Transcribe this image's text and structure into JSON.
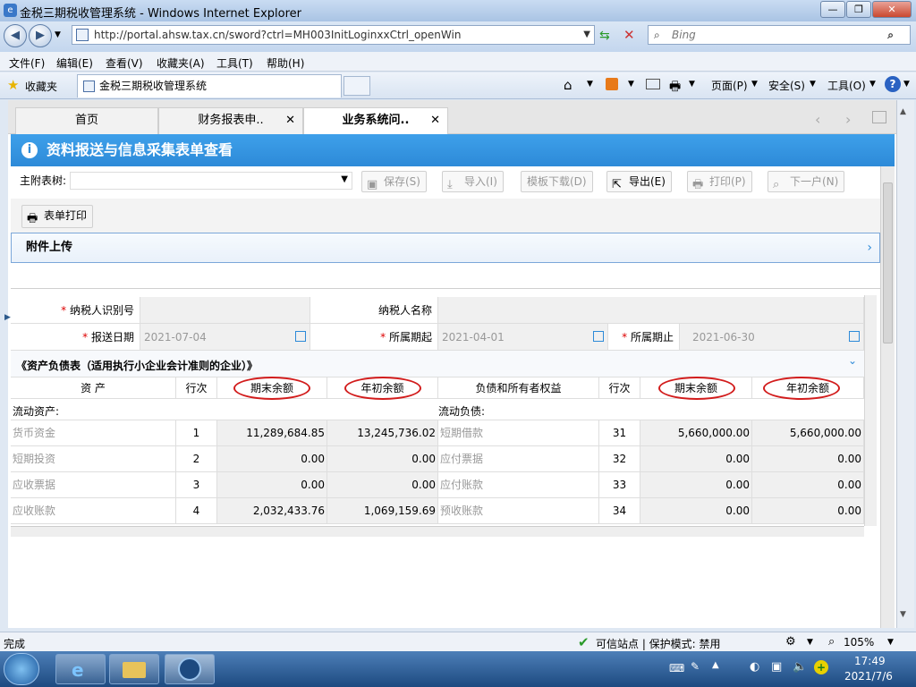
{
  "window": {
    "title": "金税三期税收管理系统 - Windows Internet Explorer"
  },
  "address": {
    "url": "http://portal.ahsw.tax.cn/sword?ctrl=MH003InitLoginxxCtrl_openWin",
    "search_placeholder": "Bing"
  },
  "menu": [
    "文件(F)",
    "编辑(E)",
    "查看(V)",
    "收藏夹(A)",
    "工具(T)",
    "帮助(H)"
  ],
  "favbar": {
    "favorites": "收藏夹",
    "tab": "金税三期税收管理系统",
    "page": "页面(P)",
    "safety": "安全(S)",
    "tools": "工具(O)"
  },
  "app_tabs": [
    {
      "label": "首页"
    },
    {
      "label": "财务报表申.."
    },
    {
      "label": "业务系统问.."
    }
  ],
  "header": {
    "title": "资料报送与信息采集表单查看"
  },
  "toolbar": {
    "tree_label": "主附表树:",
    "save": "保存(S)",
    "import": "导入(I)",
    "template": "模板下载(D)",
    "export": "导出(E)",
    "print": "打印(P)",
    "next": "下一户(N)",
    "form_print": "表单打印"
  },
  "attachment": "附件上传",
  "form": {
    "taxpayer_id_label": "纳税人识别号",
    "taxpayer_name_label": "纳税人名称",
    "report_date_label": "报送日期",
    "report_date": "2021-07-04",
    "period_start_label": "所属期起",
    "period_start": "2021-04-01",
    "period_end_label": "所属期止",
    "period_end": "2021-06-30"
  },
  "table": {
    "title": "《资产负债表（适用执行小企业会计准则的企业）》",
    "headers": [
      "资 产",
      "行次",
      "期末余额",
      "年初余额",
      "负债和所有者权益",
      "行次",
      "期末余额",
      "年初余额"
    ],
    "section_left": "流动资产:",
    "section_right": "流动负债:",
    "rows": [
      [
        "货币资金",
        "1",
        "11,289,684.85",
        "13,245,736.02",
        "短期借款",
        "31",
        "5,660,000.00",
        "5,660,000.00"
      ],
      [
        "短期投资",
        "2",
        "0.00",
        "0.00",
        "应付票据",
        "32",
        "0.00",
        "0.00"
      ],
      [
        "应收票据",
        "3",
        "0.00",
        "0.00",
        "应付账款",
        "33",
        "0.00",
        "0.00"
      ],
      [
        "应收账款",
        "4",
        "2,032,433.76",
        "1,069,159.69",
        "预收账款",
        "34",
        "0.00",
        "0.00"
      ]
    ]
  },
  "status": {
    "left": "完成",
    "trusted": "可信站点 | 保护模式: 禁用",
    "zoom": "105%"
  },
  "clock": {
    "time": "17:49",
    "date": "2021/7/6"
  },
  "colors": {
    "accent": "#2d8ad8",
    "highlight_oval": "#d21c1c"
  }
}
